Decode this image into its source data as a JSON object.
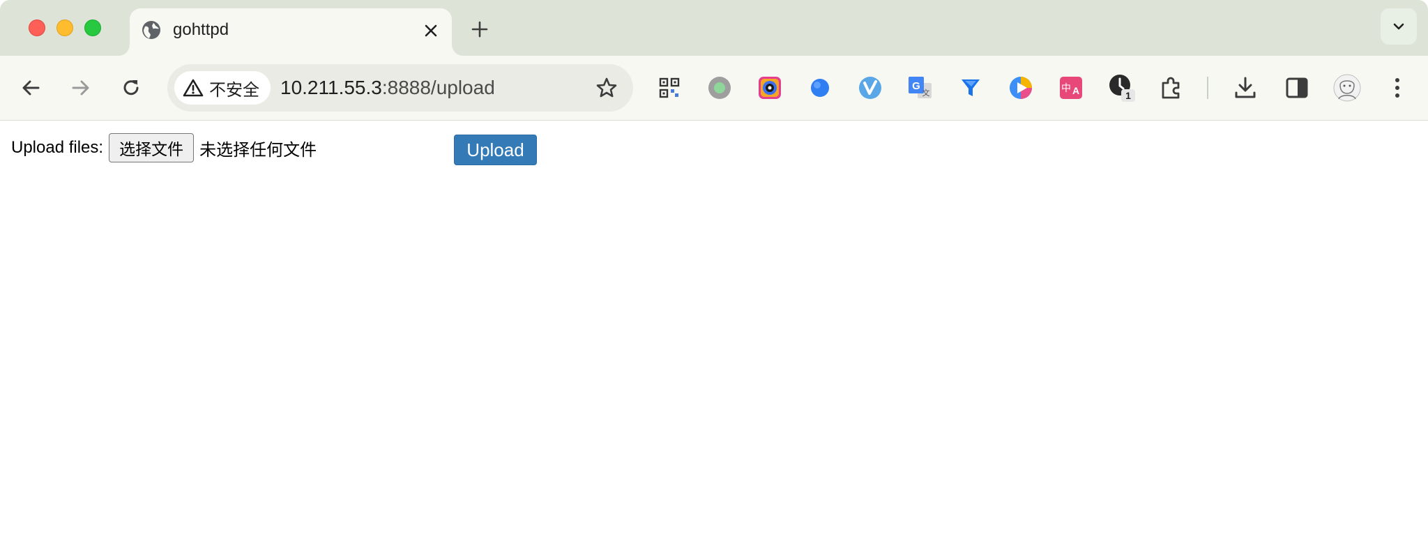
{
  "browser": {
    "tab": {
      "title": "gohttpd",
      "favicon": "globe-icon"
    },
    "new_tab_symbol": "+",
    "address_bar": {
      "security_label": "不安全",
      "host": "10.211.55.3",
      "path": ":8888/upload"
    },
    "extensions": [
      "qr-code-icon",
      "gray-circle-icon",
      "camera-icon",
      "blue-dot-icon",
      "vimium-icon",
      "google-translate-icon",
      "funnel-icon",
      "play-icon",
      "translate-zh-a-icon",
      "clock-icon",
      "puzzle-icon"
    ],
    "extension_badge": "1",
    "colors": {
      "tabstrip": "#dee3d8",
      "toolbar": "#f8f8f3",
      "accent": "#337ab7"
    }
  },
  "page": {
    "upload_label": "Upload files:",
    "choose_file_button": "选择文件",
    "no_file_text": "未选择任何文件",
    "upload_button": "Upload"
  }
}
